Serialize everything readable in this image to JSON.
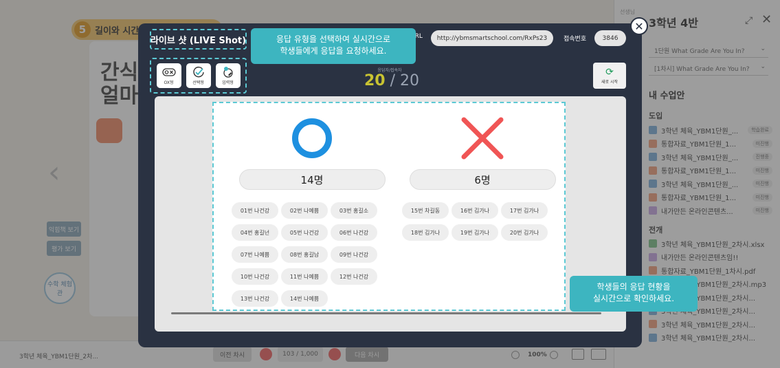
{
  "background": {
    "lesson_number": "5",
    "lesson_title": "길이와 시간",
    "card_text_line1": "간식",
    "card_text_line2": "얼마",
    "side_buttons": [
      "익힘책 보기",
      "평가 보기"
    ],
    "circle_button": "수학 체험관",
    "bottom_file": "3학년 체육_YBM1단원_2차...",
    "prev_label": "이전 차시",
    "page_label": "103 / 1,000",
    "next_label": "다음 차시",
    "zoom": "100%",
    "right_panel": {
      "small_label": "선생님",
      "class_title": "3학년 4반",
      "select1": "1단원 What Grade Are You In?",
      "select2": "[1차시] What Grade Are You In?",
      "my_plan": "내 수업안",
      "section_intro": "도입",
      "section_dev": "전개",
      "intro_items": [
        {
          "label": "3학년 체육_YBM1단원_...",
          "badge": "학습완료",
          "color": "#7fb0dd"
        },
        {
          "label": "통합자료_YBM1단원_1...",
          "badge": "미진행",
          "color": "#f2a07f"
        },
        {
          "label": "3학년 체육_YBM1단원_...",
          "badge": "진행중",
          "color": "#7fb0dd"
        },
        {
          "label": "통합자료_YBM1단원_1...",
          "badge": "미진행",
          "color": "#f2a07f"
        },
        {
          "label": "3학년 체육_YBM1단원_...",
          "badge": "미진행",
          "color": "#7fb0dd"
        },
        {
          "label": "통합자료_YBM1단원_1...",
          "badge": "미진행",
          "color": "#f2a07f"
        },
        {
          "label": "내가만든 온라인콘텐츠...",
          "badge": "미진행",
          "color": "#c9a9e6"
        }
      ],
      "dev_items": [
        {
          "label": "3학년 체육_YBM1단원_2차시.xlsx",
          "color": "#7fc28a"
        },
        {
          "label": "내가만든 온라인콘텐츠임!!",
          "color": "#c9a9e6"
        },
        {
          "label": "통합자료_YBM1단원_1차시.pdf",
          "color": "#f2a07f"
        },
        {
          "label": "3학년 체육_YBM1단원_2차시.mp3",
          "color": "#9a9a9a"
        },
        {
          "label": "3학년 체육_YBM1단원_2차시...",
          "color": "#9a9a9a"
        },
        {
          "label": "3학년 체육_YBM1단원_2차시...",
          "color": "#7fb0dd"
        },
        {
          "label": "3학년 체육_YBM1단원_2차시...",
          "color": "#f2a07f"
        },
        {
          "label": "3학년 체육_YBM1단원_2차시...",
          "color": "#7fb0dd"
        }
      ]
    }
  },
  "modal": {
    "title": "라이브 샷 (LIVE Shot)",
    "url_label": "URL",
    "url": "http://ybmsmartschool.com/RxPs23",
    "code_label": "접속번호",
    "code": "3846",
    "types": [
      {
        "label": "OX형",
        "icon": "ox-icon"
      },
      {
        "label": "선택형",
        "icon": "check-icon"
      },
      {
        "label": "입력형",
        "icon": "input-icon"
      }
    ],
    "count_label": "응답자/접속자",
    "responded": "20",
    "total": "/ 20",
    "refresh_label": "새로 시작",
    "tip_type": "응답 유형을 선택하여 실시간으로\n학생들에게 응답을 요청하세요.",
    "tip_status": "학생들의 응답 현황을\n실시간으로 확인하세요.",
    "o_count": "14명",
    "x_count": "6명",
    "o_students": [
      "01번 나건강",
      "02번 나예쁨",
      "03번 홍길소",
      "04번 홍길넌",
      "05번 나건강",
      "06번 나건강",
      "07번 나예쁨",
      "08번 홍길남",
      "09번 나건강",
      "10번 나건강",
      "11번 나예쁨",
      "12번 나건강",
      "13번 나건강",
      "14번 나예쁨"
    ],
    "x_students": [
      "15번 차길동",
      "16번 김가나",
      "17번 김가나",
      "18번 김가나",
      "19번 김가나",
      "20번 김가나"
    ],
    "colors": {
      "o_mark": "#1e90e0",
      "x_mark": "#f05555",
      "accent": "#c8c332",
      "tip": "#3db5c0"
    }
  }
}
